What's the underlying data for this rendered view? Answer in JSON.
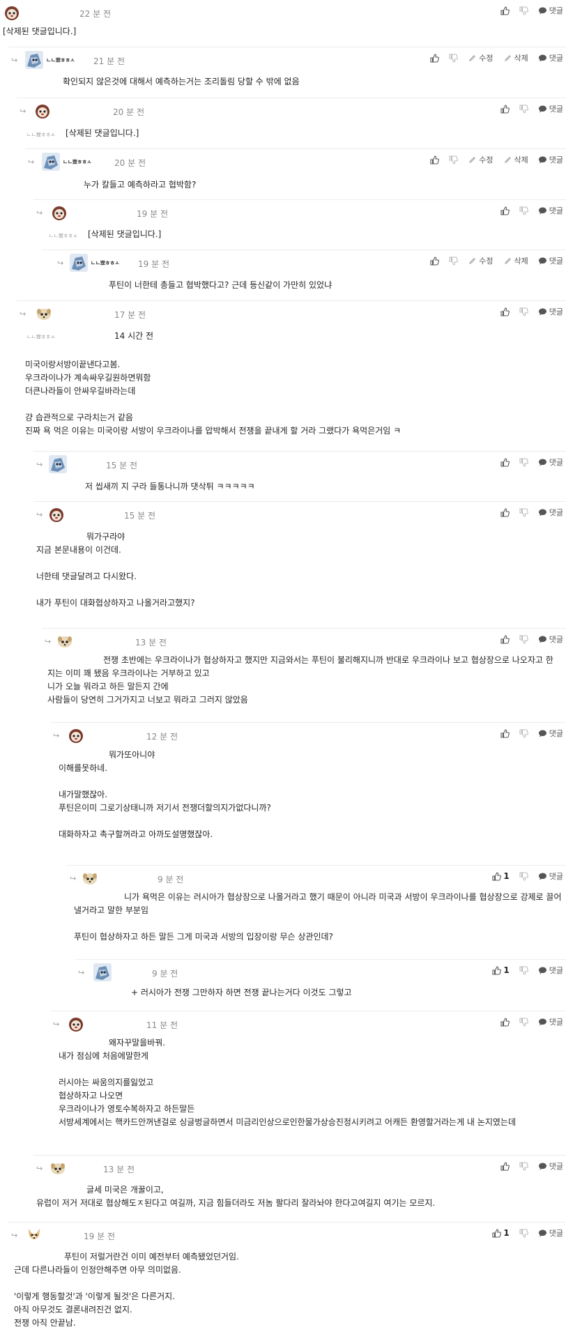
{
  "labels": {
    "reply": "댓글",
    "edit": "수정",
    "delete": "삭제"
  },
  "comments": [
    {
      "time": "22 분 전",
      "body": "[삭제된 댓글입니다.]"
    },
    {
      "nick": "ㄴㄴ뾰ㅎㅎㅅ",
      "time": "21 분 전",
      "body": "확인되지 않은것에 대해서 예측하는거는 조리돌림 당할 수 밖에 없음"
    },
    {
      "time": "20 분 전",
      "nick": "ㄴㄴ뾰ㅎㅎㅅ",
      "body": "[삭제된 댓글입니다.]"
    },
    {
      "nick": "ㄴㄴ뾰ㅎㅎㅅ",
      "time": "20 분 전",
      "body": "누가 칼들고 예측하라고 협박함?"
    },
    {
      "time": "19 분 전",
      "nick": "ㄴㄴ뾰ㅎㅎㅅ",
      "body": "[삭제된 댓글입니다.]"
    },
    {
      "nick": "ㄴㄴ뾰ㅎㅎㅅ",
      "time": "19 분 전",
      "body": "푸틴이 너한테 총들고 협박했다고? 근데 등신같이 가만히 있었냐"
    },
    {
      "time": "17 분 전",
      "nick": "ㄴㄴ뾰ㅎㅎㅅ",
      "inline": "14 시간 전",
      "body": "미국이랑서방이끝낸다고봄.\n우크라이나가 계속싸우길원하면뭐함\n더큰나라들이 안싸우길바라는데\n\n걍 습관적으로 구라치는거 같음\n진짜 욕 먹은 이유는 미국이랑 서방이 우크라이나를 압박해서 전쟁을 끝내게 할 거라 그랬다가 욕먹은거임 ㅋ"
    },
    {
      "time": "15 분 전",
      "body": "저 씹새끼 지 구라 들통나니까 댓삭튀 ㅋㅋㅋㅋㅋ"
    },
    {
      "time": "15 분 전",
      "body": "뭐가구라야\n지금 본문내용이 이건데.\n\n너한테 댓글달려고 다시왔다.\n\n내가 푸틴이 대화협상하자고 나올거라고했지?"
    },
    {
      "time": "13 분 전",
      "body": "전쟁 초반에는 우크라이나가 협상하자고 했지만 지금와서는 푸틴이 불리해지니까 반대로 우크라이나 보고 협상장으로 나오자고 한 지는 이미 꽤 됐음 우크라이나는 거부하고 있고\n니가 오늘 뭐라고 하든 말든지 간에\n사람들이 당연히 그거가지고 너보고 뭐라고 그러지 않았음"
    },
    {
      "time": "12 분 전",
      "body": "뭐가또아니야\n이해를못하네.\n\n내가말했잖아.\n푸틴은이미 그로기상태니까 저기서 전쟁더할의지가없다니까?\n\n대화하자고 촉구할꺼라고 아까도설명했잖아."
    },
    {
      "time": "9 분 전",
      "likes": "1",
      "body": "니가 욕먹은 이유는 러시아가 협상장으로 나올거라고 했기 때문이 아니라 미국과 서방이 우크라이나를 협상장으로 강제로 끌어낼거라고 말한 부분임\n\n푸틴이 협상하자고 하든 말든 그게 미국과 서방의 입장이랑 무슨 상관인데?"
    },
    {
      "time": "9 분 전",
      "likes": "1",
      "body": "+ 러시아가 전쟁 그만하자 하면 전쟁 끝나는거다 이것도 그렇고"
    },
    {
      "time": "11 분 전",
      "body": "왜자꾸말을바꿔.\n내가 점심에 처음에말한게\n\n러시아는 싸움의지를잃었고\n협상하자고 나오면\n우크라이나가 영토수복하자고 하든말든\n서방세계에서는 핵카드안꺼낸걸로 싱글벙글하면서 미금리인상으로인한물가상승진정시키려고 어캐든 환영할거라는게 내 논지였는데"
    },
    {
      "time": "13 분 전",
      "body": "글세 미국은 개꿀이고,\n유럽이 저거 저대로 협상해도ㅈ된다고 여길까, 지금 힘들더라도 저놈 팔다리 잘라놔야 한다고여길지 여기는 모르지."
    },
    {
      "time": "19 분 전",
      "likes": "1",
      "body": "푸틴이 저럴거란건 이미 예전부터 예측됐었던거임.\n근데 다른나라들이 인정안해주면 아무 의미없음.\n\n'이렇게 행동할것'과 '이렇게 될것'은 다른거지.\n아직 아무것도 결론내려진건 없지.\n전쟁 아직 안끝남."
    }
  ]
}
